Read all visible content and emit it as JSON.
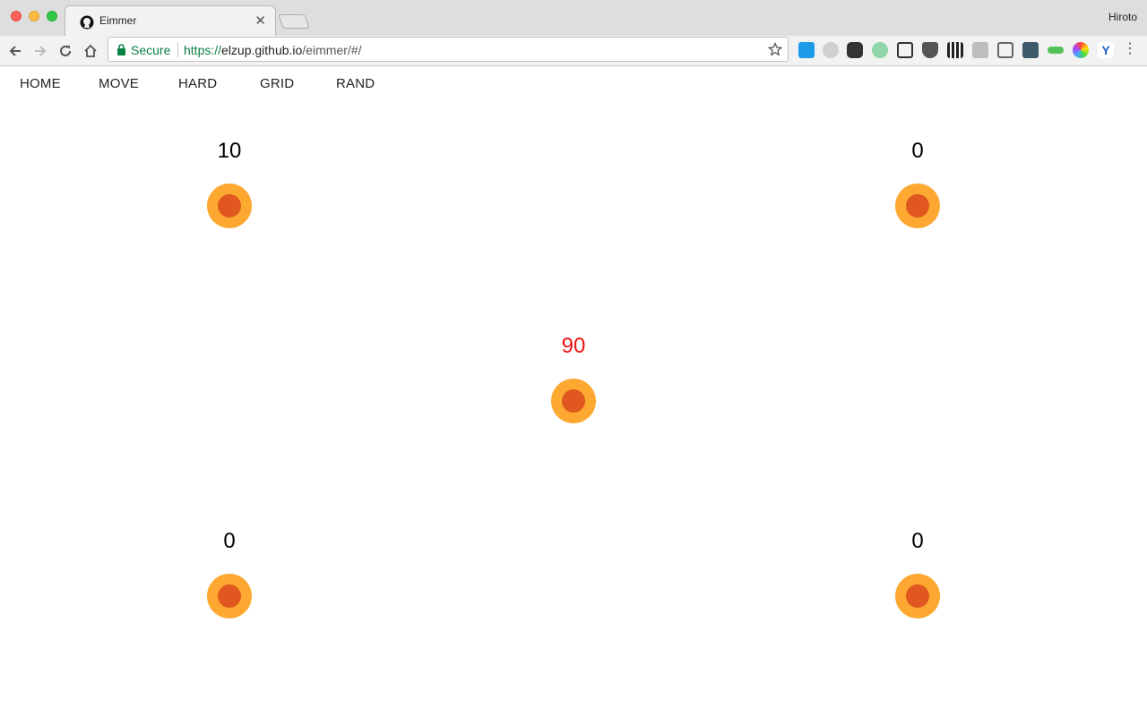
{
  "browser": {
    "tab_title": "Eimmer",
    "profile_name": "Hiroto",
    "secure_label": "Secure",
    "url_scheme": "https://",
    "url_host": "elzup.github.io",
    "url_path": "/eimmer/#/",
    "extensions": [
      "translate-icon",
      "stylebot-icon",
      "ghostery-icon",
      "color-picker-icon",
      "screenshot-icon",
      "pocket-icon",
      "qr-code-icon",
      "reader-icon",
      "cast-icon",
      "grammarly-icon",
      "toggle-icon",
      "color-wheel-icon",
      "yoast-icon"
    ]
  },
  "nav": {
    "items": [
      {
        "label": "HOME"
      },
      {
        "label": "MOVE"
      },
      {
        "label": "HARD"
      },
      {
        "label": "GRID"
      },
      {
        "label": "RAND"
      }
    ]
  },
  "targets": [
    {
      "position": "top-left",
      "score": "10",
      "highlight": false
    },
    {
      "position": "top-right",
      "score": "0",
      "highlight": false
    },
    {
      "position": "center",
      "score": "90",
      "highlight": true
    },
    {
      "position": "bottom-left",
      "score": "0",
      "highlight": false
    },
    {
      "position": "bottom-right",
      "score": "0",
      "highlight": false
    }
  ],
  "colors": {
    "ring": "#fda831",
    "core": "#e0571f",
    "highlight_score": "#ee1111",
    "secure_green": "#0b8043"
  }
}
